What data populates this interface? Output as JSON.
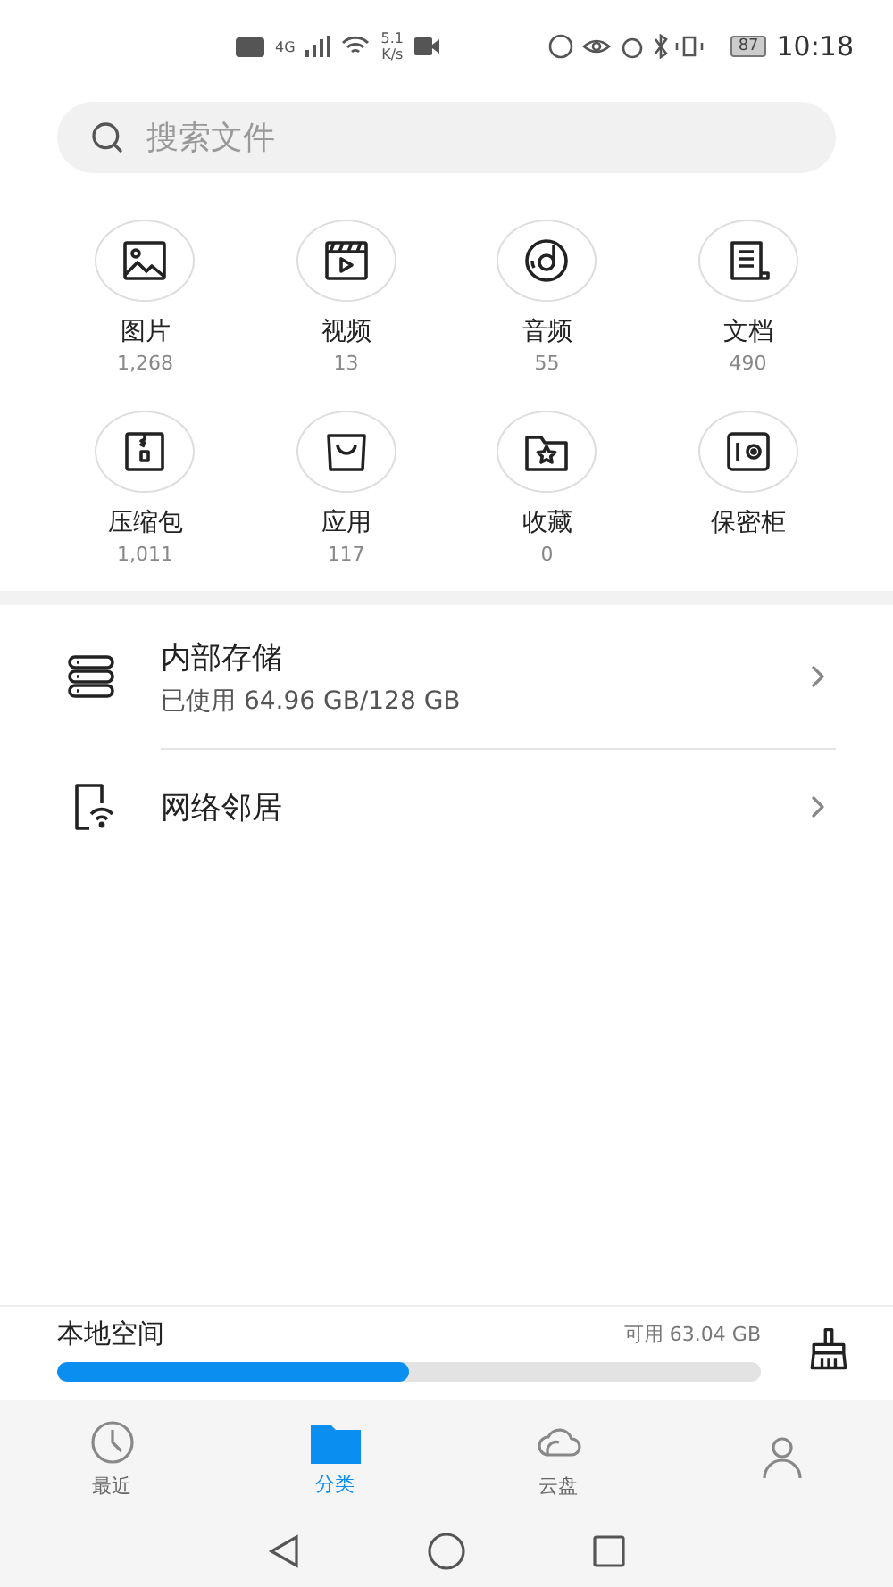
{
  "status_bar": {
    "network": "4G",
    "speed": "5.1",
    "speed_unit": "K/s",
    "battery": "87",
    "time": "10:18"
  },
  "search": {
    "placeholder": "搜索文件"
  },
  "categories": [
    {
      "label": "图片",
      "count": "1,268"
    },
    {
      "label": "视频",
      "count": "13"
    },
    {
      "label": "音频",
      "count": "55"
    },
    {
      "label": "文档",
      "count": "490"
    },
    {
      "label": "压缩包",
      "count": "1,011"
    },
    {
      "label": "应用",
      "count": "117"
    },
    {
      "label": "收藏",
      "count": "0"
    },
    {
      "label": "保密柜"
    }
  ],
  "locations": [
    {
      "title": "内部存储",
      "subtitle": "已使用 64.96 GB/128 GB"
    },
    {
      "title": "网络邻居"
    }
  ],
  "local_space": {
    "title": "本地空间",
    "available": "可用 63.04 GB",
    "level": 0.5
  },
  "bottom_tabs": [
    {
      "label": "最近",
      "selected": false
    },
    {
      "label": "分类",
      "selected": true
    },
    {
      "label": "云盘",
      "selected": false
    },
    {
      "selected": false
    }
  ]
}
